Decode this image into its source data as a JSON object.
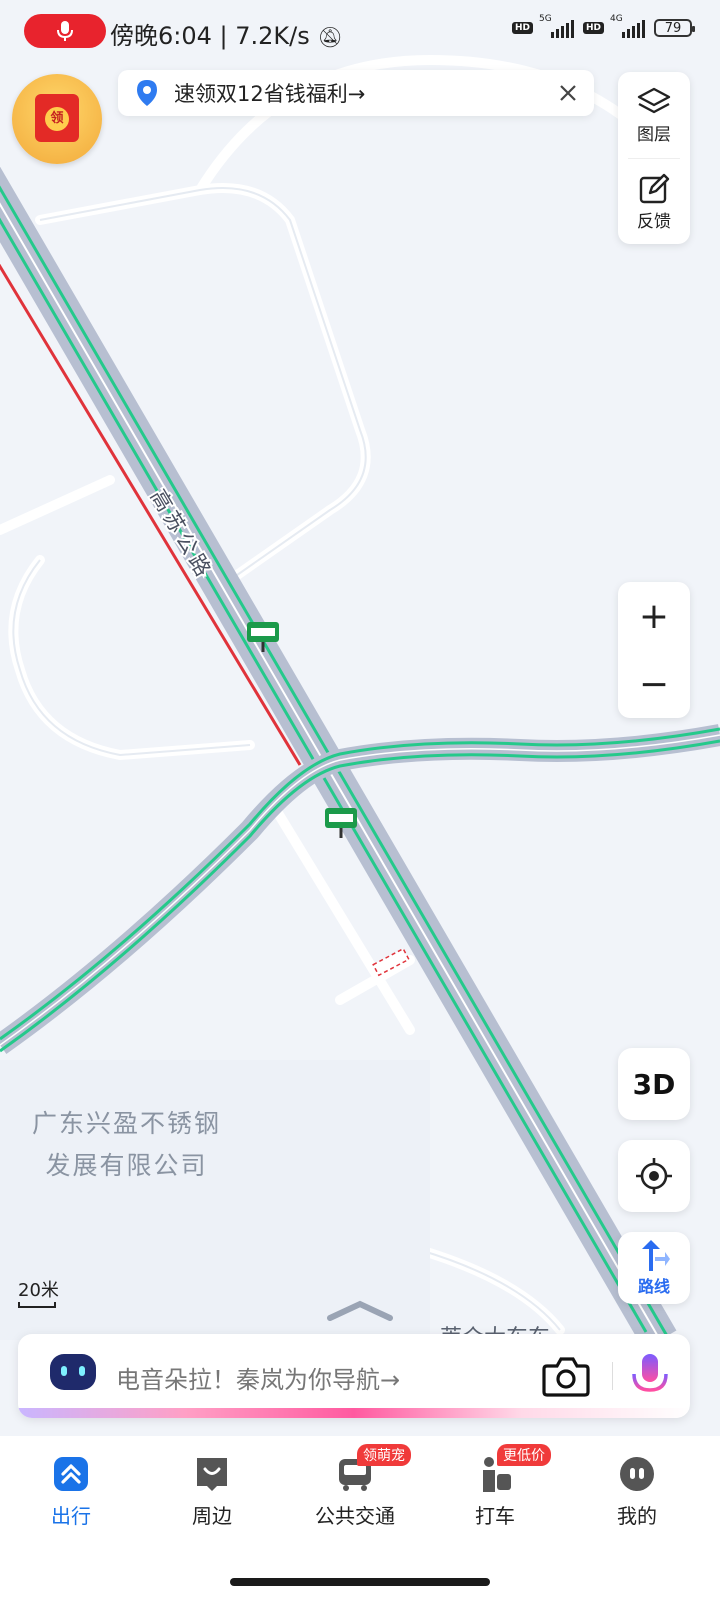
{
  "status_bar": {
    "time": "傍晚6:04",
    "speed": "7.2K/s",
    "net1": "5G",
    "net2": "4G",
    "hd": "HD",
    "battery": "79"
  },
  "promo_banner": {
    "text": "速领双12省钱福利→"
  },
  "avatar_badge": "领",
  "side_controls": {
    "layers_label": "图层",
    "feedback_label": "反馈"
  },
  "zoom": {
    "in": "+",
    "out": "−"
  },
  "map": {
    "road_name": "高苏公路",
    "poi_company_line1": "广东兴盈不锈钢",
    "poi_company_line2": "发展有限公司",
    "scale_label": "20米",
    "partial_label": "莱介大东东"
  },
  "buttons": {
    "three_d": "3D",
    "route": "路线"
  },
  "search": {
    "placeholder": "电音朵拉！秦岚为你导航→"
  },
  "tabs": [
    {
      "label": "出行",
      "icon": "travel-icon",
      "active": true
    },
    {
      "label": "周边",
      "icon": "nearby-icon"
    },
    {
      "label": "公共交通",
      "icon": "bus-icon",
      "badge": "领萌宠"
    },
    {
      "label": "打车",
      "icon": "taxi-icon",
      "badge": "更低价"
    },
    {
      "label": "我的",
      "icon": "profile-icon"
    }
  ],
  "colors": {
    "accent": "#1a73e8",
    "road_green": "#25c98b",
    "road_red": "#e0333b",
    "road_fill": "#b7bfd1"
  }
}
